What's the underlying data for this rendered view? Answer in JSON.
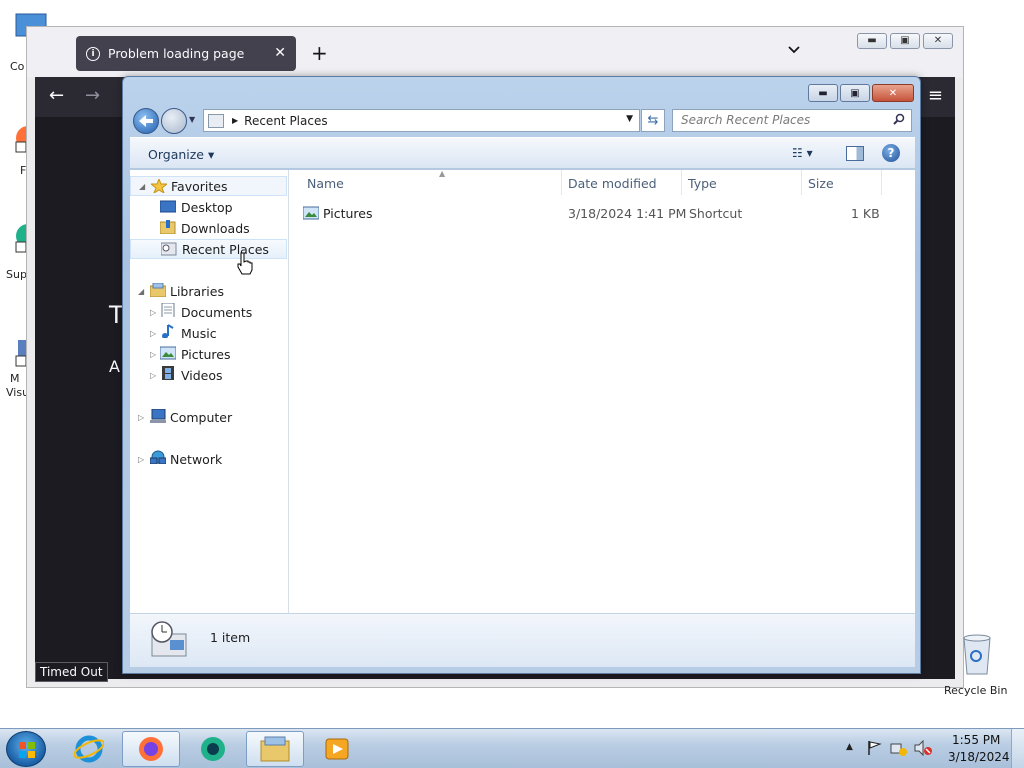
{
  "firefox": {
    "tab_title": "Problem loading page",
    "tab_close": "✕",
    "new_tab": "+",
    "list_all_tabs": "⌄",
    "back": "←",
    "forward": "→",
    "menu": "≡",
    "error_title_partial": "T",
    "error_sub_partial": "A",
    "status_text": "Timed Out"
  },
  "explorer": {
    "address": "Recent Places",
    "search_placeholder": "Search Recent Places",
    "organize": "Organize ▾",
    "views_glyph": "☷ ▾",
    "help": "?",
    "tree": {
      "favorites": "Favorites",
      "desktop": "Desktop",
      "downloads": "Downloads",
      "recent_places": "Recent Places",
      "libraries": "Libraries",
      "documents": "Documents",
      "music": "Music",
      "pictures": "Pictures",
      "videos": "Videos",
      "computer": "Computer",
      "network": "Network"
    },
    "columns": {
      "name": "Name",
      "date_modified": "Date modified",
      "type": "Type",
      "size": "Size"
    },
    "files": [
      {
        "name": "Pictures",
        "date_modified": "3/18/2024 1:41 PM",
        "type": "Shortcut",
        "size": "1 KB"
      }
    ],
    "item_count": "1 item"
  },
  "desktop": {
    "recycle_bin": "Recycle Bin"
  },
  "taskbar": {
    "time": "1:55 PM",
    "date": "3/18/2024"
  }
}
